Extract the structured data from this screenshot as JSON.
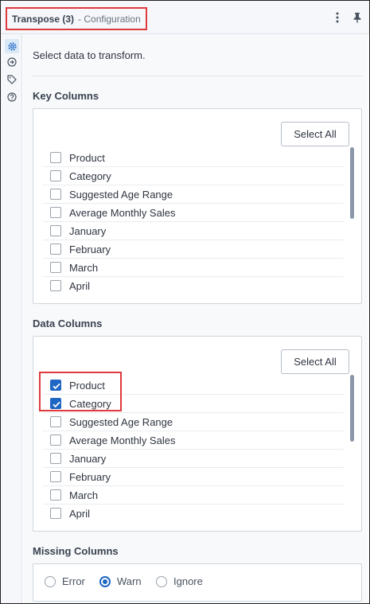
{
  "header": {
    "title": "Transpose (3)",
    "subtitle": "- Configuration",
    "icons": {
      "more": "kebab-icon",
      "pin": "pin-icon"
    }
  },
  "rail": {
    "icons": [
      "gear-icon",
      "arrow-circle-icon",
      "tag-icon",
      "help-icon"
    ]
  },
  "intro": "Select data to transform.",
  "key_columns": {
    "label": "Key Columns",
    "select_all_label": "Select All",
    "items": [
      {
        "label": "Product",
        "checked": false
      },
      {
        "label": "Category",
        "checked": false
      },
      {
        "label": "Suggested Age Range",
        "checked": false
      },
      {
        "label": "Average Monthly Sales",
        "checked": false
      },
      {
        "label": "January",
        "checked": false
      },
      {
        "label": "February",
        "checked": false
      },
      {
        "label": "March",
        "checked": false
      },
      {
        "label": "April",
        "checked": false
      }
    ]
  },
  "data_columns": {
    "label": "Data Columns",
    "select_all_label": "Select All",
    "items": [
      {
        "label": "Product",
        "checked": true
      },
      {
        "label": "Category",
        "checked": true
      },
      {
        "label": "Suggested Age Range",
        "checked": false
      },
      {
        "label": "Average Monthly Sales",
        "checked": false
      },
      {
        "label": "January",
        "checked": false
      },
      {
        "label": "February",
        "checked": false
      },
      {
        "label": "March",
        "checked": false
      },
      {
        "label": "April",
        "checked": false
      }
    ]
  },
  "missing_columns": {
    "label": "Missing Columns",
    "options": [
      {
        "label": "Error",
        "selected": false
      },
      {
        "label": "Warn",
        "selected": true
      },
      {
        "label": "Ignore",
        "selected": false
      }
    ]
  },
  "colors": {
    "accent": "#1e66c4",
    "highlight": "#e0393e"
  }
}
